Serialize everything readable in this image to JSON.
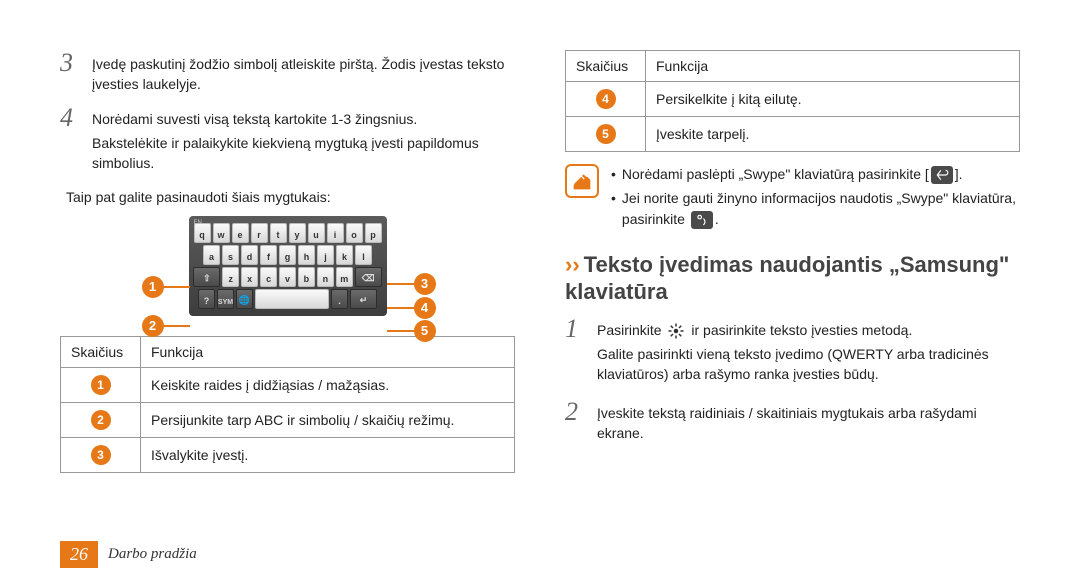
{
  "leftColumn": {
    "step3": {
      "num": "3",
      "text": "Įvedę paskutinį žodžio simbolį atleiskite pirštą. Žodis įvestas teksto įvesties laukelyje."
    },
    "step4": {
      "num": "4",
      "line1": "Norėdami suvesti visą tekstą kartokite 1-3 žingsnius.",
      "line2": "Bakstelėkite ir palaikykite kiekvieną mygtuką įvesti papildomus simbolius."
    },
    "afterSteps": "Taip pat galite pasinaudoti šiais mygtukais:",
    "kbd": {
      "r1": [
        "q",
        "w",
        "e",
        "r",
        "t",
        "y",
        "u",
        "i",
        "o",
        "p"
      ],
      "r2": [
        "a",
        "s",
        "d",
        "f",
        "g",
        "h",
        "j",
        "k",
        "l"
      ],
      "r3": [
        "z",
        "x",
        "c",
        "v",
        "b",
        "n",
        "m"
      ],
      "sym": "SYM",
      "en": "EN"
    },
    "callouts": {
      "c1": "1",
      "c2": "2",
      "c3": "3",
      "c4": "4",
      "c5": "5"
    },
    "table": {
      "hdrNum": "Skaičius",
      "hdrFunc": "Funkcija",
      "rows": [
        {
          "n": "1",
          "f": "Keiskite raides į didžiąsias / mažąsias."
        },
        {
          "n": "2",
          "f": "Persijunkite tarp ABC ir simbolių / skaičių režimų."
        },
        {
          "n": "3",
          "f": "Išvalykite įvestį."
        }
      ]
    }
  },
  "rightColumn": {
    "table": {
      "hdrNum": "Skaičius",
      "hdrFunc": "Funkcija",
      "rows": [
        {
          "n": "4",
          "f": "Persikelkite į kitą eilutę."
        },
        {
          "n": "5",
          "f": "Įveskite tarpelį."
        }
      ]
    },
    "note": {
      "bullet1a": "Norėdami paslėpti „Swype\" klaviatūrą pasirinkite [",
      "bullet1b": "].",
      "bullet2a": "Jei norite gauti žinyno informacijos naudotis „Swype\" klaviatūra, pasirinkite",
      "bullet2b": "."
    },
    "heading": "Teksto įvedimas naudojantis „Samsung\" klaviatūra",
    "step1": {
      "num": "1",
      "line1a": "Pasirinkite",
      "line1b": "ir pasirinkite teksto įvesties metodą.",
      "line2": "Galite pasirinkti vieną teksto įvedimo (QWERTY arba tradicinės klaviatūros) arba rašymo ranka įvesties būdų."
    },
    "step2": {
      "num": "2",
      "text": "Įveskite tekstą raidiniais / skaitiniais mygtukais arba rašydami ekrane."
    }
  },
  "footer": {
    "page": "26",
    "section": "Darbo pradžia"
  }
}
